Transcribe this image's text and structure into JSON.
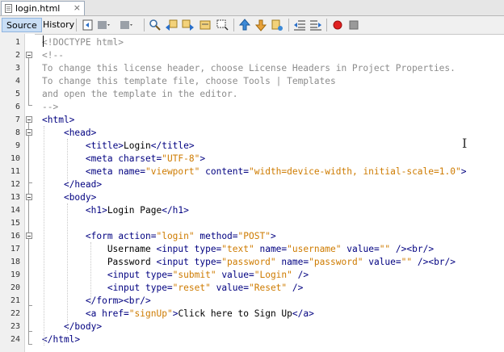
{
  "tab": {
    "filename": "login.html",
    "close_glyph": "×"
  },
  "toolbar": {
    "source_label": "Source",
    "history_label": "History",
    "icons": [
      "last-edit-icon",
      "back-icon",
      "forward-icon",
      "find-icon",
      "find-prev-icon",
      "find-next-icon",
      "toggle-highlight-icon",
      "toggle-rect-select-icon",
      "prev-bookmark-icon",
      "next-bookmark-icon",
      "toggle-bookmark-icon",
      "shift-left-icon",
      "shift-right-icon",
      "record-macro-icon",
      "stop-macro-icon"
    ]
  },
  "colors": {
    "tag": "#000080",
    "attr_value": "#ce7b00",
    "comment": "#8c8c8c",
    "record": "#e02020"
  },
  "editor": {
    "lines": [
      {
        "n": "1",
        "segs": [
          [
            "doctype",
            "<!DOCTYPE html>"
          ]
        ]
      },
      {
        "n": "2",
        "segs": [
          [
            "comment",
            "<!--"
          ]
        ]
      },
      {
        "n": "3",
        "segs": [
          [
            "comment",
            "To change this license header, choose License Headers in Project Properties."
          ]
        ]
      },
      {
        "n": "4",
        "segs": [
          [
            "comment",
            "To change this template file, choose Tools | Templates"
          ]
        ]
      },
      {
        "n": "5",
        "segs": [
          [
            "comment",
            "and open the template in the editor."
          ]
        ]
      },
      {
        "n": "6",
        "segs": [
          [
            "comment",
            "-->"
          ]
        ]
      },
      {
        "n": "7",
        "segs": [
          [
            "tag",
            "<html>"
          ]
        ]
      },
      {
        "n": "8",
        "segs": [
          [
            "text",
            "    "
          ],
          [
            "tag",
            "<head>"
          ]
        ]
      },
      {
        "n": "9",
        "segs": [
          [
            "text",
            "        "
          ],
          [
            "tag",
            "<title>"
          ],
          [
            "text",
            "Login"
          ],
          [
            "tag",
            "</title>"
          ]
        ]
      },
      {
        "n": "10",
        "segs": [
          [
            "text",
            "        "
          ],
          [
            "tag",
            "<meta "
          ],
          [
            "attr",
            "charset="
          ],
          [
            "val",
            "\"UTF-8\""
          ],
          [
            "tag",
            ">"
          ]
        ]
      },
      {
        "n": "11",
        "segs": [
          [
            "text",
            "        "
          ],
          [
            "tag",
            "<meta "
          ],
          [
            "attr",
            "name="
          ],
          [
            "val",
            "\"viewport\""
          ],
          [
            "text",
            " "
          ],
          [
            "attr",
            "content="
          ],
          [
            "val",
            "\"width=device-width, initial-scale=1.0\""
          ],
          [
            "tag",
            ">"
          ]
        ]
      },
      {
        "n": "12",
        "segs": [
          [
            "text",
            "    "
          ],
          [
            "tag",
            "</head>"
          ]
        ]
      },
      {
        "n": "13",
        "segs": [
          [
            "text",
            "    "
          ],
          [
            "tag",
            "<body>"
          ]
        ]
      },
      {
        "n": "14",
        "segs": [
          [
            "text",
            "        "
          ],
          [
            "tag",
            "<h1>"
          ],
          [
            "text",
            "Login Page"
          ],
          [
            "tag",
            "</h1>"
          ]
        ]
      },
      {
        "n": "15",
        "segs": []
      },
      {
        "n": "16",
        "segs": [
          [
            "text",
            "        "
          ],
          [
            "tag",
            "<form "
          ],
          [
            "attr",
            "action="
          ],
          [
            "val",
            "\"login\""
          ],
          [
            "text",
            " "
          ],
          [
            "attr",
            "method="
          ],
          [
            "val",
            "\"POST\""
          ],
          [
            "tag",
            ">"
          ]
        ]
      },
      {
        "n": "17",
        "segs": [
          [
            "text",
            "            Username "
          ],
          [
            "tag",
            "<input "
          ],
          [
            "attr",
            "type="
          ],
          [
            "val",
            "\"text\""
          ],
          [
            "text",
            " "
          ],
          [
            "attr",
            "name="
          ],
          [
            "val",
            "\"username\""
          ],
          [
            "text",
            " "
          ],
          [
            "attr",
            "value="
          ],
          [
            "val",
            "\"\""
          ],
          [
            "text",
            " "
          ],
          [
            "tag",
            "/><br/>"
          ]
        ]
      },
      {
        "n": "18",
        "segs": [
          [
            "text",
            "            Password "
          ],
          [
            "tag",
            "<input "
          ],
          [
            "attr",
            "type="
          ],
          [
            "val",
            "\"password\""
          ],
          [
            "text",
            " "
          ],
          [
            "attr",
            "name="
          ],
          [
            "val",
            "\"password\""
          ],
          [
            "text",
            " "
          ],
          [
            "attr",
            "value="
          ],
          [
            "val",
            "\"\""
          ],
          [
            "text",
            " "
          ],
          [
            "tag",
            "/><br/>"
          ]
        ]
      },
      {
        "n": "19",
        "segs": [
          [
            "text",
            "            "
          ],
          [
            "tag",
            "<input "
          ],
          [
            "attr",
            "type="
          ],
          [
            "val",
            "\"submit\""
          ],
          [
            "text",
            " "
          ],
          [
            "attr",
            "value="
          ],
          [
            "val",
            "\"Login\""
          ],
          [
            "text",
            " "
          ],
          [
            "tag",
            "/>"
          ]
        ]
      },
      {
        "n": "20",
        "segs": [
          [
            "text",
            "            "
          ],
          [
            "tag",
            "<input "
          ],
          [
            "attr",
            "type="
          ],
          [
            "val",
            "\"reset\""
          ],
          [
            "text",
            " "
          ],
          [
            "attr",
            "value="
          ],
          [
            "val",
            "\"Reset\""
          ],
          [
            "text",
            " "
          ],
          [
            "tag",
            "/>"
          ]
        ]
      },
      {
        "n": "21",
        "segs": [
          [
            "text",
            "        "
          ],
          [
            "tag",
            "</form><br/>"
          ]
        ]
      },
      {
        "n": "22",
        "segs": [
          [
            "text",
            "        "
          ],
          [
            "tag",
            "<a "
          ],
          [
            "attr",
            "href="
          ],
          [
            "val",
            "\"signUp\""
          ],
          [
            "tag",
            ">"
          ],
          [
            "text",
            "Click here to Sign Up"
          ],
          [
            "tag",
            "</a>"
          ]
        ]
      },
      {
        "n": "23",
        "segs": [
          [
            "text",
            "    "
          ],
          [
            "tag",
            "</body>"
          ]
        ]
      },
      {
        "n": "24",
        "segs": [
          [
            "tag",
            "</html>"
          ]
        ]
      }
    ]
  }
}
